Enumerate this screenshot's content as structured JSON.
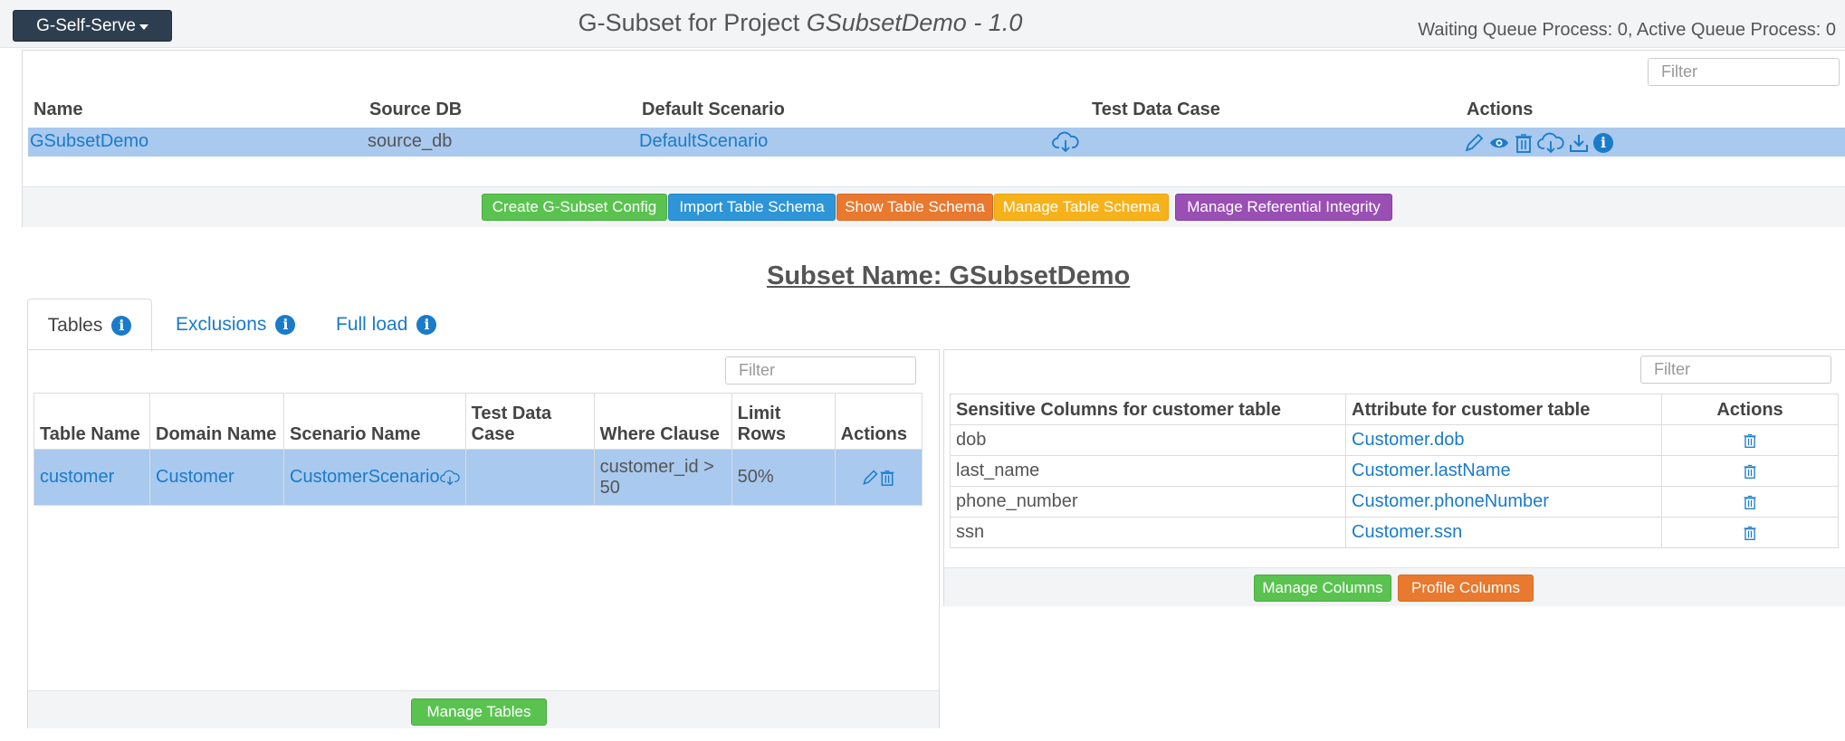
{
  "topbar": {
    "menu_label": "G-Self-Serve",
    "title_prefix": "G-Subset for Project ",
    "title_project": "GSubsetDemo - 1.0",
    "queue_status": "Waiting Queue Process: 0, Active Queue Process: 0"
  },
  "project_panel": {
    "filter_placeholder": "Filter",
    "headers": [
      "Name",
      "Source DB",
      "Default Scenario",
      "Test Data Case",
      "Actions"
    ],
    "row": {
      "name": "GSubsetDemo",
      "source_db": "source_db",
      "default_scenario": "DefaultScenario"
    },
    "buttons": {
      "create": "Create G-Subset Config",
      "import": "Import Table Schema",
      "show": "Show Table Schema",
      "manage": "Manage Table Schema",
      "integrity": "Manage Referential Integrity"
    }
  },
  "subset_title": "Subset Name: GSubsetDemo",
  "tabs": [
    "Tables",
    "Exclusions",
    "Full load"
  ],
  "tables_panel": {
    "filter_placeholder": "Filter",
    "headers": [
      "Table Name",
      "Domain Name",
      "Scenario Name",
      "Test Data Case",
      "Where Clause",
      "Limit Rows",
      "Actions"
    ],
    "row": {
      "table_name": "customer",
      "domain_name": "Customer",
      "scenario_name": "CustomerScenario",
      "test_data_case": "",
      "where_clause": "customer_id > 50",
      "limit_rows": "50%"
    },
    "button_manage": "Manage Tables"
  },
  "columns_panel": {
    "filter_placeholder": "Filter",
    "headers": [
      "Sensitive Columns for customer table",
      "Attribute for customer table",
      "Actions"
    ],
    "rows": [
      {
        "column": "dob",
        "attribute": "Customer.dob"
      },
      {
        "column": "last_name",
        "attribute": "Customer.lastName"
      },
      {
        "column": "phone_number",
        "attribute": "Customer.phoneNumber"
      },
      {
        "column": "ssn",
        "attribute": "Customer.ssn"
      }
    ],
    "button_manage": "Manage Columns",
    "button_profile": "Profile Columns"
  },
  "colors": {
    "accent": "#1a7bc9",
    "selected_row": "#a9c9ee",
    "green": "#5ac350",
    "blue": "#2d95d8",
    "orange": "#e8792f",
    "yellow": "#f7b21b",
    "purple": "#9a4fb4"
  }
}
